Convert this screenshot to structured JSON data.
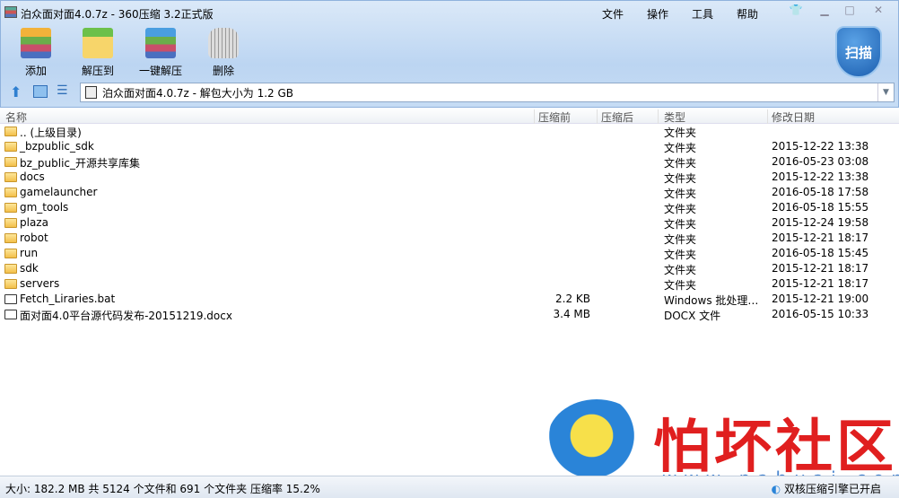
{
  "title": "泊众面对面4.0.7z - 360压缩 3.2正式版",
  "menu": [
    "文件",
    "操作",
    "工具",
    "帮助"
  ],
  "toolbar": [
    {
      "label": "添加"
    },
    {
      "label": "解压到"
    },
    {
      "label": "一键解压"
    },
    {
      "label": "删除"
    }
  ],
  "scan_label": "扫描",
  "path": "泊众面对面4.0.7z - 解包大小为 1.2 GB",
  "columns": [
    "名称",
    "压缩前",
    "压缩后",
    "类型",
    "修改日期"
  ],
  "rows": [
    {
      "name": ".. (上级目录)",
      "size": "",
      "packed": "",
      "type": "文件夹",
      "date": "",
      "icon": "folder"
    },
    {
      "name": "_bzpublic_sdk",
      "size": "",
      "packed": "",
      "type": "文件夹",
      "date": "2015-12-22 13:38",
      "icon": "folder"
    },
    {
      "name": "bz_public_开源共享库集",
      "size": "",
      "packed": "",
      "type": "文件夹",
      "date": "2016-05-23 03:08",
      "icon": "folder"
    },
    {
      "name": "docs",
      "size": "",
      "packed": "",
      "type": "文件夹",
      "date": "2015-12-22 13:38",
      "icon": "folder"
    },
    {
      "name": "gamelauncher",
      "size": "",
      "packed": "",
      "type": "文件夹",
      "date": "2016-05-18 17:58",
      "icon": "folder"
    },
    {
      "name": "gm_tools",
      "size": "",
      "packed": "",
      "type": "文件夹",
      "date": "2016-05-18 15:55",
      "icon": "folder"
    },
    {
      "name": "plaza",
      "size": "",
      "packed": "",
      "type": "文件夹",
      "date": "2015-12-24 19:58",
      "icon": "folder"
    },
    {
      "name": "robot",
      "size": "",
      "packed": "",
      "type": "文件夹",
      "date": "2015-12-21 18:17",
      "icon": "folder"
    },
    {
      "name": "run",
      "size": "",
      "packed": "",
      "type": "文件夹",
      "date": "2016-05-18 15:45",
      "icon": "folder"
    },
    {
      "name": "sdk",
      "size": "",
      "packed": "",
      "type": "文件夹",
      "date": "2015-12-21 18:17",
      "icon": "folder"
    },
    {
      "name": "servers",
      "size": "",
      "packed": "",
      "type": "文件夹",
      "date": "2015-12-21 18:17",
      "icon": "folder"
    },
    {
      "name": "Fetch_Liraries.bat",
      "size": "2.2 KB",
      "packed": "",
      "type": "Windows 批处理…",
      "date": "2015-12-21 19:00",
      "icon": "file"
    },
    {
      "name": "面对面4.0平台源代码发布-20151219.docx",
      "size": "3.4 MB",
      "packed": "",
      "type": "DOCX 文件",
      "date": "2016-05-15 10:33",
      "icon": "file"
    }
  ],
  "status": "大小: 182.2 MB 共 5124 个文件和 691 个文件夹 压缩率 15.2%",
  "engine": "双核压缩引擎已开启",
  "watermark": {
    "name": "怕坏社区",
    "url": "www.pahuai.com"
  }
}
